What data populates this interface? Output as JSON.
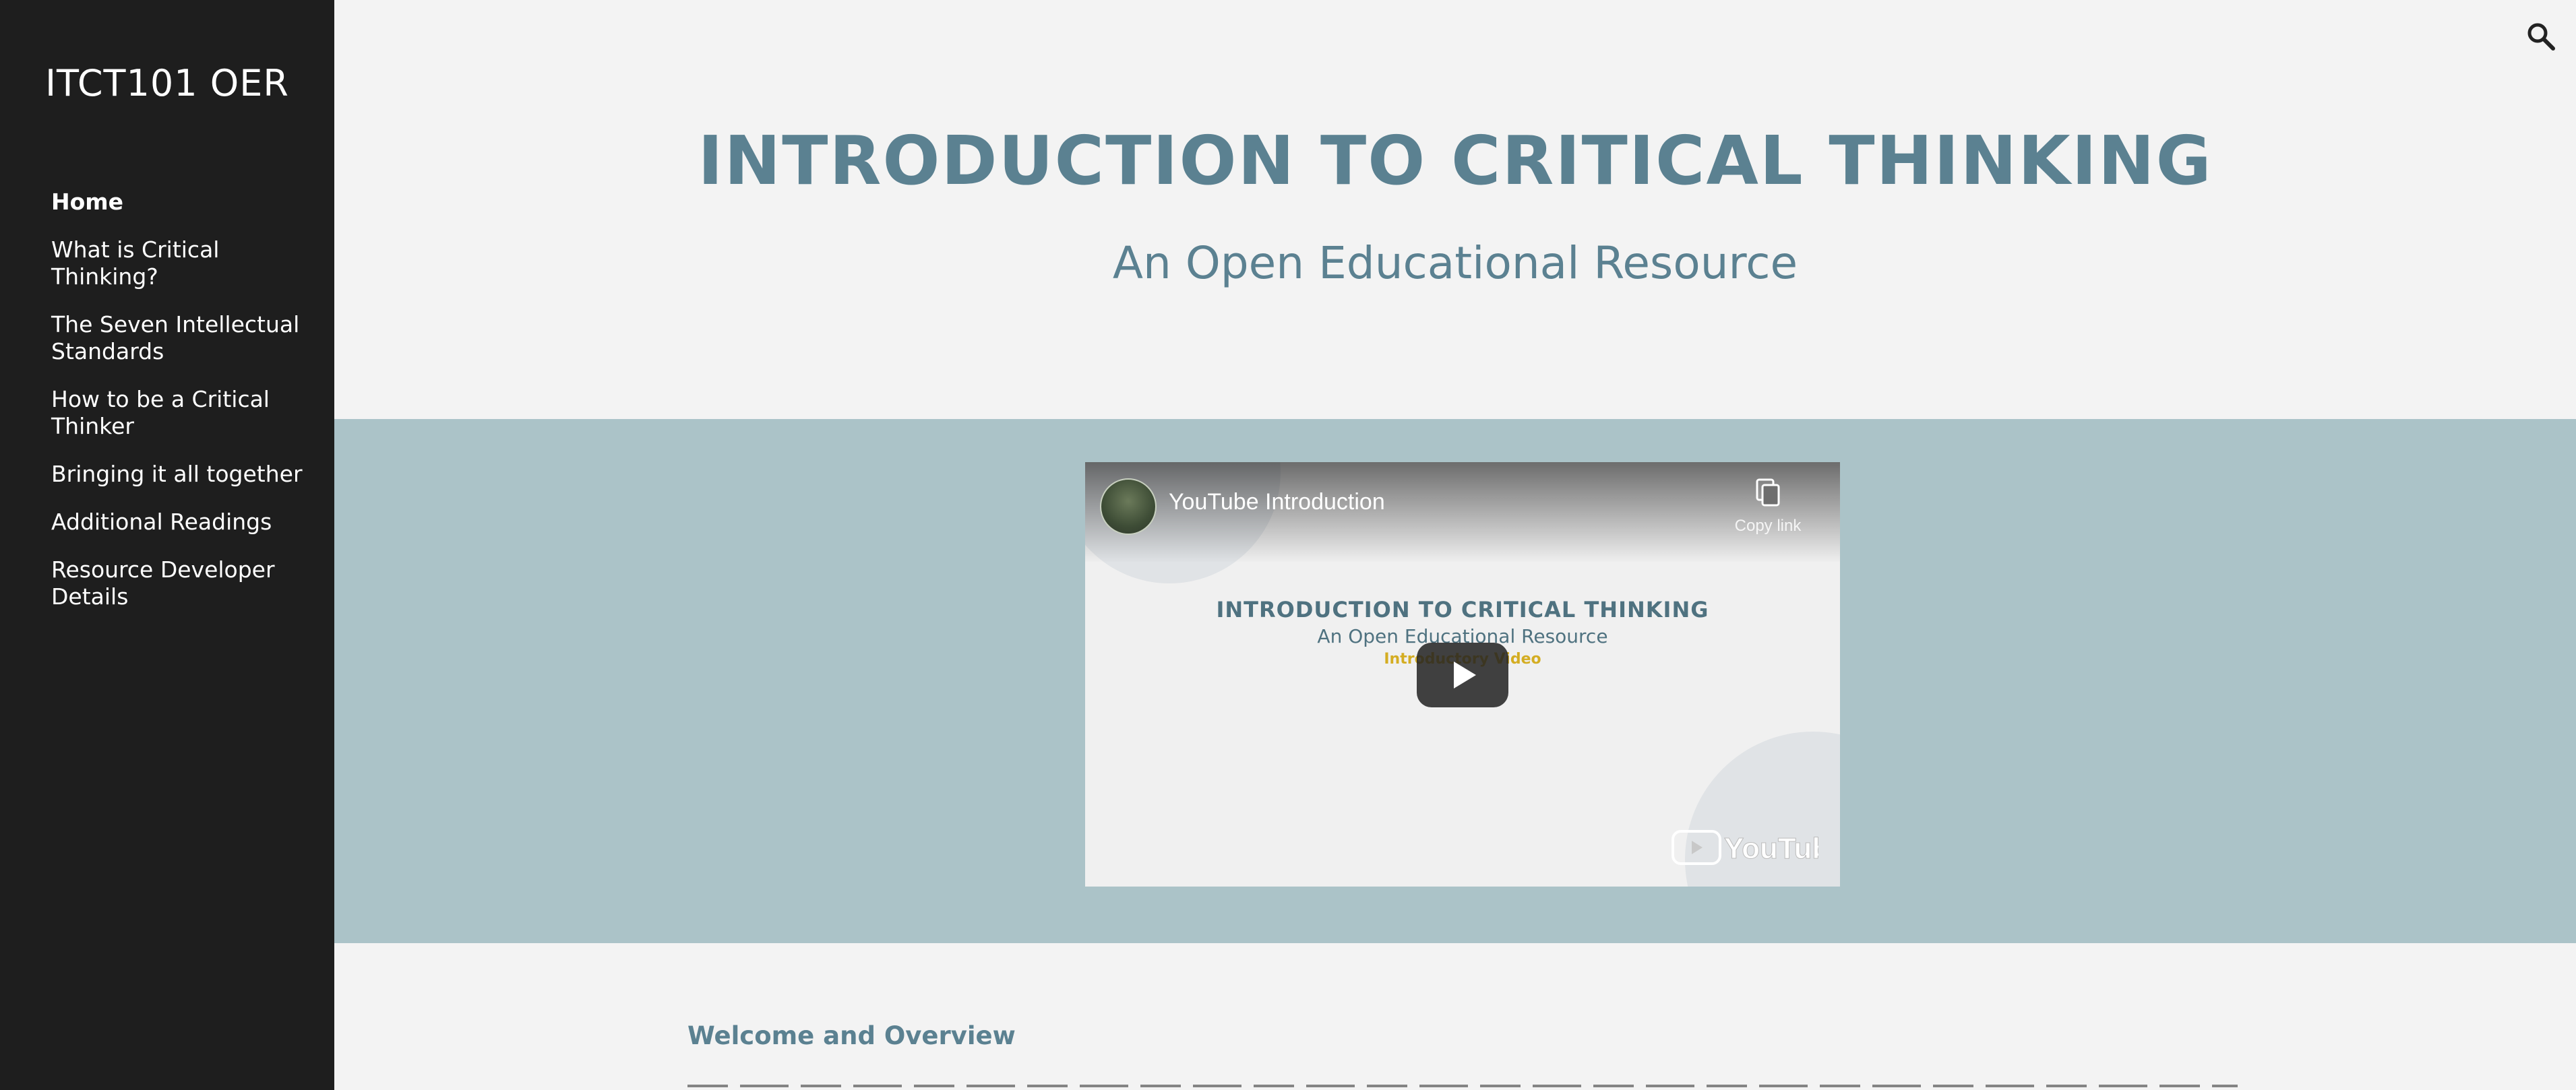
{
  "sidebar": {
    "site_title": "ITCT101 OER",
    "items": [
      {
        "label": "Home",
        "active": true
      },
      {
        "label": "What is Critical Thinking?",
        "active": false
      },
      {
        "label": "The Seven Intellectual Standards",
        "active": false
      },
      {
        "label": "How to be a Critical Thinker",
        "active": false
      },
      {
        "label": "Bringing it all together",
        "active": false
      },
      {
        "label": "Additional Readings",
        "active": false
      },
      {
        "label": "Resource Developer Details",
        "active": false
      }
    ]
  },
  "header": {
    "search_icon": "search-icon",
    "title": "INTRODUCTION TO CRITICAL THINKING",
    "subtitle": "An Open Educational Resource"
  },
  "video": {
    "title": "YouTube Introduction",
    "copy_label": "Copy link",
    "thumbnail_title": "INTRODUCTION TO CRITICAL THINKING",
    "thumbnail_subtitle": "An Open Educational Resource",
    "thumbnail_tag": "Introductory Video",
    "logo_text": "YouTube"
  },
  "content": {
    "section_heading": "Welcome and Overview"
  },
  "colors": {
    "sidebar_bg": "#1e1e1e",
    "page_bg": "#f3f3f3",
    "accent": "#5b8191",
    "band_bg": "#abc3c8",
    "thumb_tag": "#d4ad22"
  }
}
